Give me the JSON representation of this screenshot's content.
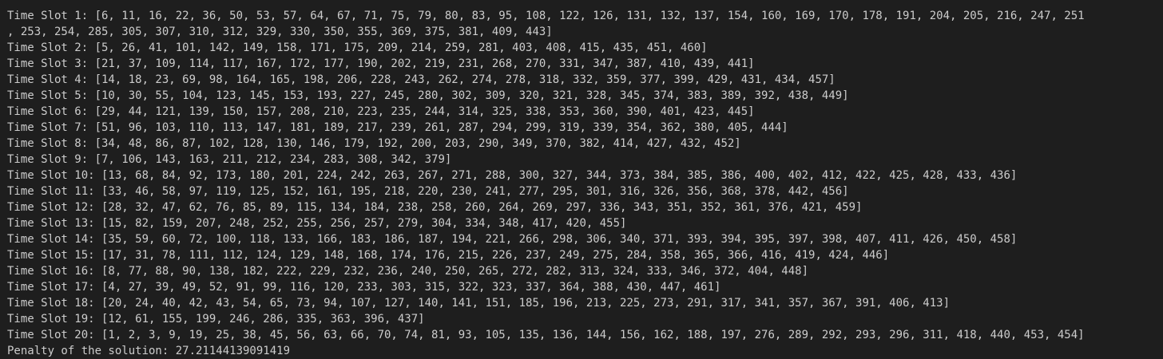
{
  "terminal": {
    "lines": [
      "Time Slot 1: [6, 11, 16, 22, 36, 50, 53, 57, 64, 67, 71, 75, 79, 80, 83, 95, 108, 122, 126, 131, 132, 137, 154, 160, 169, 170, 178, 191, 204, 205, 216, 247, 251",
      ", 253, 254, 285, 305, 307, 310, 312, 329, 330, 350, 355, 369, 375, 381, 409, 443]",
      "Time Slot 2: [5, 26, 41, 101, 142, 149, 158, 171, 175, 209, 214, 259, 281, 403, 408, 415, 435, 451, 460]",
      "Time Slot 3: [21, 37, 109, 114, 117, 167, 172, 177, 190, 202, 219, 231, 268, 270, 331, 347, 387, 410, 439, 441]",
      "Time Slot 4: [14, 18, 23, 69, 98, 164, 165, 198, 206, 228, 243, 262, 274, 278, 318, 332, 359, 377, 399, 429, 431, 434, 457]",
      "Time Slot 5: [10, 30, 55, 104, 123, 145, 153, 193, 227, 245, 280, 302, 309, 320, 321, 328, 345, 374, 383, 389, 392, 438, 449]",
      "Time Slot 6: [29, 44, 121, 139, 150, 157, 208, 210, 223, 235, 244, 314, 325, 338, 353, 360, 390, 401, 423, 445]",
      "Time Slot 7: [51, 96, 103, 110, 113, 147, 181, 189, 217, 239, 261, 287, 294, 299, 319, 339, 354, 362, 380, 405, 444]",
      "Time Slot 8: [34, 48, 86, 87, 102, 128, 130, 146, 179, 192, 200, 203, 290, 349, 370, 382, 414, 427, 432, 452]",
      "Time Slot 9: [7, 106, 143, 163, 211, 212, 234, 283, 308, 342, 379]",
      "Time Slot 10: [13, 68, 84, 92, 173, 180, 201, 224, 242, 263, 267, 271, 288, 300, 327, 344, 373, 384, 385, 386, 400, 402, 412, 422, 425, 428, 433, 436]",
      "Time Slot 11: [33, 46, 58, 97, 119, 125, 152, 161, 195, 218, 220, 230, 241, 277, 295, 301, 316, 326, 356, 368, 378, 442, 456]",
      "Time Slot 12: [28, 32, 47, 62, 76, 85, 89, 115, 134, 184, 238, 258, 260, 264, 269, 297, 336, 343, 351, 352, 361, 376, 421, 459]",
      "Time Slot 13: [15, 82, 159, 207, 248, 252, 255, 256, 257, 279, 304, 334, 348, 417, 420, 455]",
      "Time Slot 14: [35, 59, 60, 72, 100, 118, 133, 166, 183, 186, 187, 194, 221, 266, 298, 306, 340, 371, 393, 394, 395, 397, 398, 407, 411, 426, 450, 458]",
      "Time Slot 15: [17, 31, 78, 111, 112, 124, 129, 148, 168, 174, 176, 215, 226, 237, 249, 275, 284, 358, 365, 366, 416, 419, 424, 446]",
      "Time Slot 16: [8, 77, 88, 90, 138, 182, 222, 229, 232, 236, 240, 250, 265, 272, 282, 313, 324, 333, 346, 372, 404, 448]",
      "Time Slot 17: [4, 27, 39, 49, 52, 91, 99, 116, 120, 233, 303, 315, 322, 323, 337, 364, 388, 430, 447, 461]",
      "Time Slot 18: [20, 24, 40, 42, 43, 54, 65, 73, 94, 107, 127, 140, 141, 151, 185, 196, 213, 225, 273, 291, 317, 341, 357, 367, 391, 406, 413]",
      "Time Slot 19: [12, 61, 155, 199, 246, 286, 335, 363, 396, 437]",
      "Time Slot 20: [1, 2, 3, 9, 19, 25, 38, 45, 56, 63, 66, 70, 74, 81, 93, 105, 135, 136, 144, 156, 162, 188, 197, 276, 289, 292, 293, 296, 311, 418, 440, 453, 454]",
      "Penalty of the solution: 27.21144139091419"
    ]
  }
}
